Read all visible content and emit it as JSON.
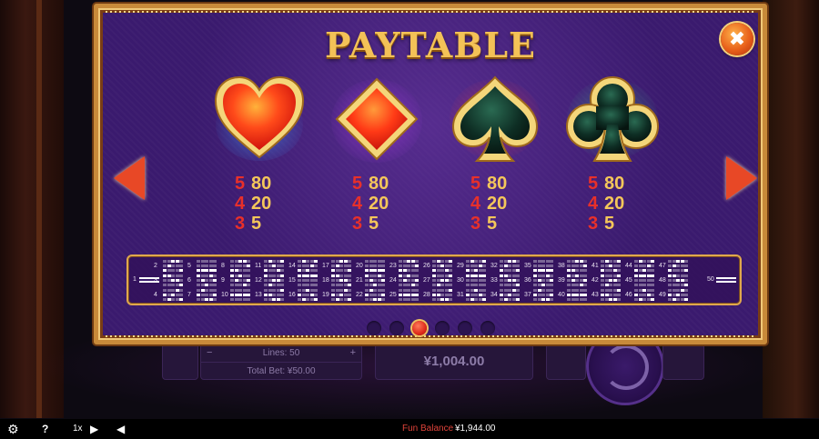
{
  "paytable": {
    "title": "PAYTABLE",
    "close_icon": "close-icon",
    "symbols": [
      {
        "name": "heart",
        "color": "#e8281a",
        "payouts": [
          {
            "count": "5",
            "value": "80"
          },
          {
            "count": "4",
            "value": "20"
          },
          {
            "count": "3",
            "value": "5"
          }
        ]
      },
      {
        "name": "diamond",
        "color": "#e8281a",
        "payouts": [
          {
            "count": "5",
            "value": "80"
          },
          {
            "count": "4",
            "value": "20"
          },
          {
            "count": "3",
            "value": "5"
          }
        ]
      },
      {
        "name": "spade",
        "color": "#0e2a22",
        "payouts": [
          {
            "count": "5",
            "value": "80"
          },
          {
            "count": "4",
            "value": "20"
          },
          {
            "count": "3",
            "value": "5"
          }
        ]
      },
      {
        "name": "club",
        "color": "#0e2a22",
        "payouts": [
          {
            "count": "5",
            "value": "80"
          },
          {
            "count": "4",
            "value": "20"
          },
          {
            "count": "3",
            "value": "5"
          }
        ]
      }
    ],
    "paylines": {
      "first": "1",
      "last": "50",
      "count": 50
    },
    "pages": {
      "total": 6,
      "active": 3
    }
  },
  "background": {
    "lines_label": "Lines: 50",
    "total_bet_label": "Total Bet: ¥50.00",
    "minus": "−",
    "plus": "+",
    "balance": "¥1,004.00"
  },
  "status_bar": {
    "speed": "1x",
    "help": "?",
    "fun_balance_label": "Fun Balance",
    "fun_balance_value": "¥1,944.00"
  }
}
